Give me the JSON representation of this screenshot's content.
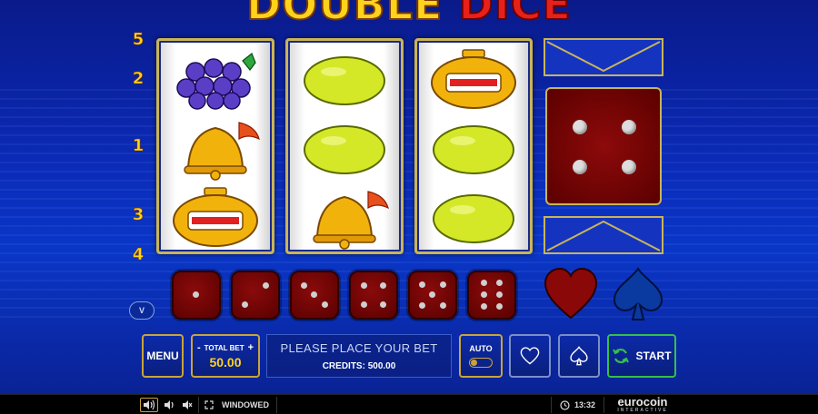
{
  "game": {
    "title_part1": "DOUBLE",
    "title_part2": "DICE"
  },
  "paylines": [
    {
      "number": "5"
    },
    {
      "number": "2"
    },
    {
      "number": "1"
    },
    {
      "number": "3"
    },
    {
      "number": "4"
    }
  ],
  "reels": [
    {
      "symbols": [
        "grapes",
        "bell",
        "stopwatch"
      ]
    },
    {
      "symbols": [
        "lemon",
        "lemon",
        "bell"
      ]
    },
    {
      "symbols": [
        "stopwatch",
        "lemon",
        "lemon"
      ]
    }
  ],
  "big_die": {
    "value": 4
  },
  "small_dice": [
    1,
    2,
    3,
    4,
    5,
    6
  ],
  "gamble_suits": [
    "heart",
    "spade"
  ],
  "badge": {
    "label": "V"
  },
  "controls": {
    "menu_label": "MENU",
    "minus_label": "-",
    "plus_label": "+",
    "total_bet_label": "TOTAL BET",
    "total_bet_value": "50.00",
    "message": "PLEASE PLACE YOUR BET",
    "credits_label": "CREDITS: 500.00",
    "auto_label": "AUTO",
    "auto_enabled": false,
    "start_label": "START"
  },
  "footer": {
    "windowed_label": "WINDOWED",
    "clock": "13:32",
    "brand": "eurocoin",
    "brand_sub": "INTERACTIVE"
  },
  "colors": {
    "background": "#0b2bb8",
    "gold": "#ffd21c",
    "die_red": "#7a0606",
    "start_green": "#35c04a"
  }
}
